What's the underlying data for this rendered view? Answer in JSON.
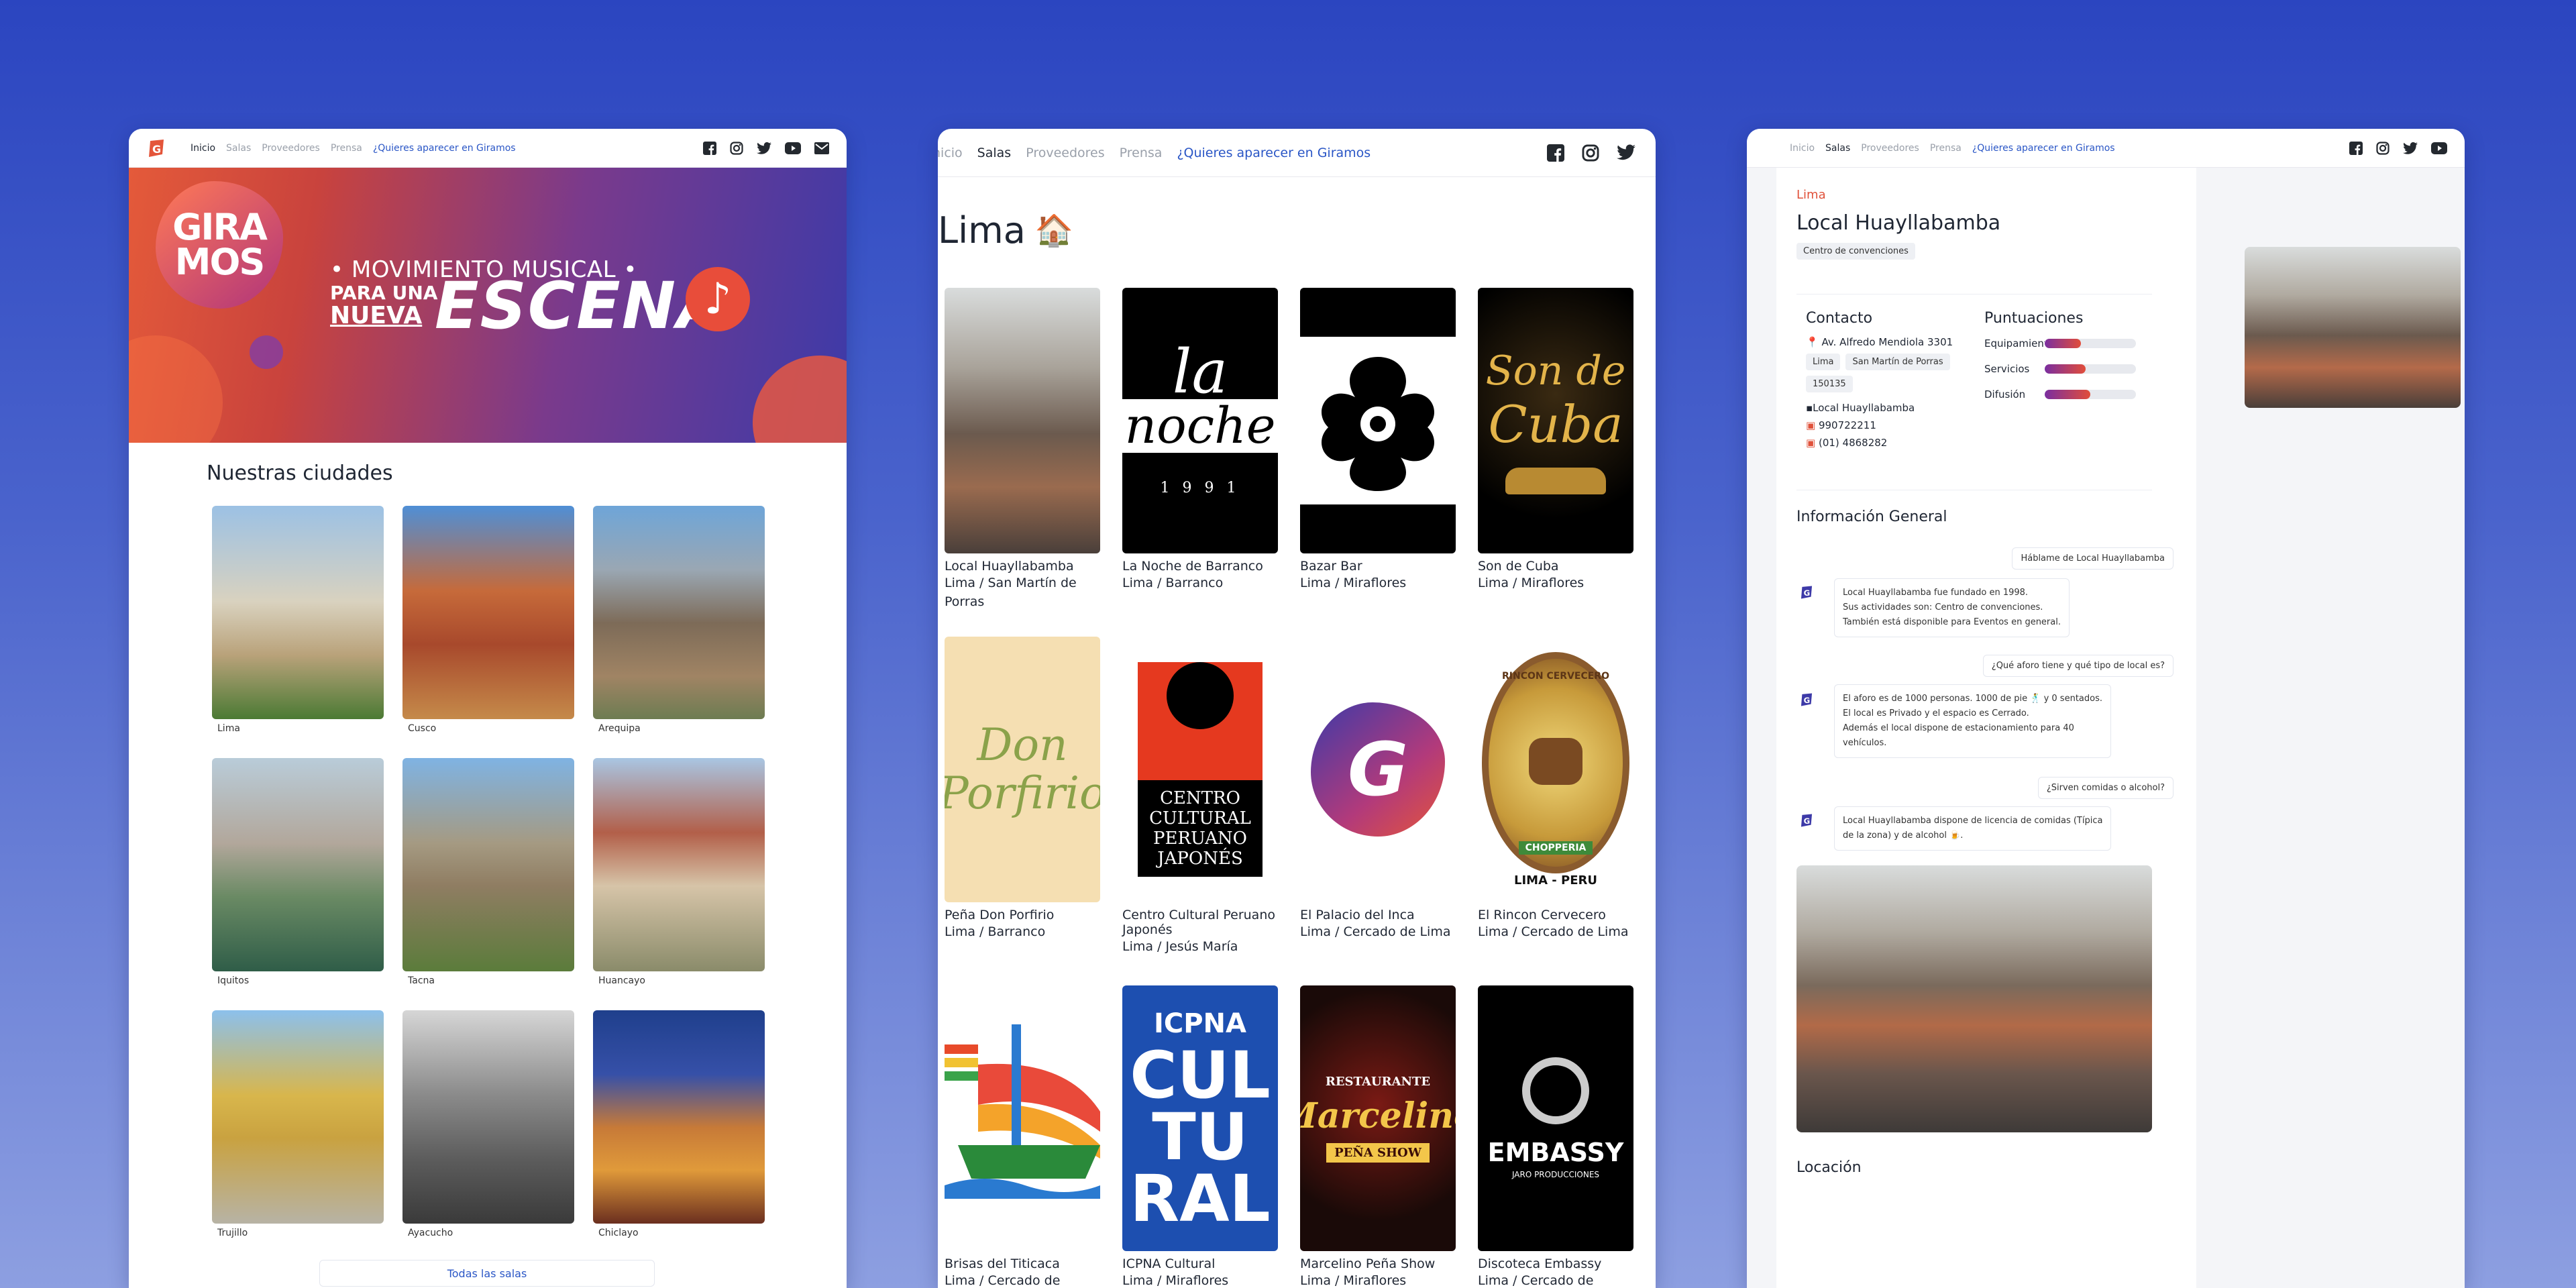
{
  "nav": {
    "inicio": "Inicio",
    "salas": "Salas",
    "proveedores": "Proveedores",
    "prensa": "Prensa",
    "promo": "¿Quieres aparecer en Giramos",
    "inicio_cut": "nicio"
  },
  "hero": {
    "brand_line1": "GIRA",
    "brand_line2": "MOS",
    "tagline1": "MOVIMIENTO MUSICAL",
    "tagline2a": "PARA UNA",
    "tagline2b": "NUEVA",
    "tagline3": "ESCENA"
  },
  "home": {
    "section_title": "Nuestras ciudades",
    "cities": [
      "Lima",
      "Cusco",
      "Arequipa",
      "Iquitos",
      "Tacna",
      "Huancayo",
      "Trujillo",
      "Ayacucho",
      "Chiclayo"
    ],
    "all_button": "Todas las salas"
  },
  "salas": {
    "city_title": "Lima",
    "city_emoji": "🏠",
    "venues": [
      {
        "name": "Local Huayllabamba",
        "loc": "Lima / San Martín de Porras"
      },
      {
        "name": "La Noche de Barranco",
        "loc": "Lima / Barranco"
      },
      {
        "name": "Bazar Bar",
        "loc": "Lima / Miraflores"
      },
      {
        "name": "Son de Cuba",
        "loc": "Lima / Miraflores"
      },
      {
        "name": "Peña Don Porfirio",
        "loc": "Lima / Barranco"
      },
      {
        "name": "Centro Cultural Peruano Japonés",
        "loc": "Lima / Jesús María"
      },
      {
        "name": "El Palacio del Inca",
        "loc": "Lima / Cercado de Lima"
      },
      {
        "name": "El Rincon Cervecero",
        "loc": "Lima / Cercado de Lima"
      },
      {
        "name": "Brisas del Titicaca",
        "loc": "Lima / Cercado de"
      },
      {
        "name": "ICPNA Cultural",
        "loc": "Lima / Miraflores"
      },
      {
        "name": "Marcelino Peña Show",
        "loc": "Lima / Miraflores"
      },
      {
        "name": "Discoteca Embassy",
        "loc": "Lima / Cercado de"
      }
    ],
    "poster_text": {
      "lanoche_1": "la",
      "lanoche_2": "noche",
      "lanoche_year": "1 9 9 1",
      "soncuba_1": "Son de",
      "soncuba_2": "Cuba",
      "donporfirio": "Don Porfirio",
      "ccpj_1": "CENTRO",
      "ccpj_2": "CULTURAL",
      "ccpj_3": "PERUANO",
      "ccpj_4": "JAPONÉS",
      "palacio_g": "G",
      "rincon_top": "RINCON CERVECERO",
      "rincon_bottom": "CHOPPERIA",
      "rincon_city": "LIMA - PERU",
      "icpna_1": "ICPNA",
      "icpna_2": "CUL",
      "icpna_3": "TU",
      "icpna_4": "RAL",
      "marcelino_top": "RESTAURANTE",
      "marcelino_name": "Marcelino",
      "marcelino_bottom": "PEÑA SHOW",
      "embassy_1": "EMBASSY",
      "embassy_2": "JARO PRODUCCIONES"
    }
  },
  "detail": {
    "breadcrumb": "Lima",
    "title": "Local Huayllabamba",
    "category": "Centro de convenciones",
    "contact_title": "Contacto",
    "address": "Av. Alfredo Mendiola 3301",
    "chips": [
      "Lima",
      "San Martín de Porras",
      "150135"
    ],
    "owner": "Local Huayllabamba",
    "phone1": "990722211",
    "phone2": "(01) 4868282",
    "scores_title": "Puntuaciones",
    "scores": [
      {
        "label": "Equipamiento",
        "value": 0.4
      },
      {
        "label": "Servicios",
        "value": 0.45
      },
      {
        "label": "Difusión",
        "value": 0.5
      }
    ],
    "info_title": "Información General",
    "q1": "Háblame de Local Huayllabamba",
    "a1_l1": "Local Huayllabamba fue fundado en 1998.",
    "a1_l2": "Sus actividades son: Centro de convenciones.",
    "a1_l3": "También está disponible para Eventos en general.",
    "q2": "¿Qué aforo tiene y qué tipo de local es?",
    "a2_l1": "El aforo es de 1000 personas. 1000 de pie 🕺 y 0 sentados.",
    "a2_l2": "El local es Privado y el espacio es Cerrado.",
    "a2_l3": "Además el local dispone de estacionamiento para 40",
    "a2_l4": "vehículos.",
    "q3": "¿Sirven comidas o alcohol?",
    "a3_l1": "Local Huayllabamba dispone de licencia de comidas (Típica",
    "a3_l2": "de la zona) y de alcohol 🍺.",
    "location_title": "Locación"
  }
}
